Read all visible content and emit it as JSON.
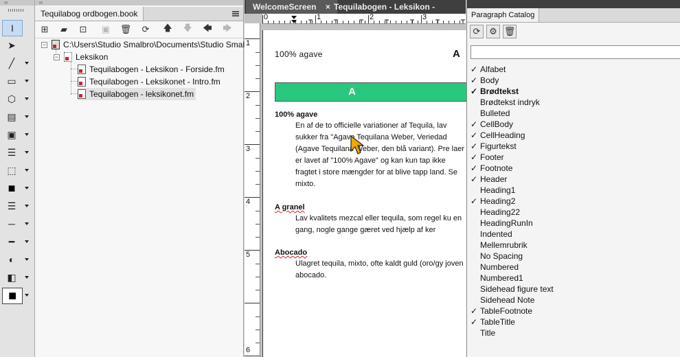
{
  "toolbox": {
    "collapse_glyph": "‹‹",
    "tools": [
      {
        "name": "smart-select-tool",
        "glyph": "I",
        "selected": true
      },
      {
        "name": "object-select-tool",
        "glyph": "➤"
      },
      {
        "name": "line-tool",
        "glyph": "╱"
      },
      {
        "name": "rectangle-tool",
        "glyph": "▭"
      },
      {
        "name": "polygon-tool",
        "glyph": "⬡"
      },
      {
        "name": "text-frame-tool",
        "glyph": "▤"
      },
      {
        "name": "graphic-frame-tool",
        "glyph": "▣"
      },
      {
        "name": "paragraph-tool",
        "glyph": "☰"
      },
      {
        "name": "selection-box-tool",
        "glyph": "⬚"
      },
      {
        "name": "fill-color-tool",
        "glyph": "■"
      },
      {
        "name": "line-width-tool",
        "glyph": "☰"
      },
      {
        "name": "line-end-tool",
        "glyph": "─"
      },
      {
        "name": "dash-tool",
        "glyph": "━"
      },
      {
        "name": "tint-tool",
        "glyph": "◐"
      },
      {
        "name": "overprint-tool",
        "glyph": "◧"
      },
      {
        "name": "stroke-color-tool",
        "glyph": "■"
      }
    ]
  },
  "book_panel": {
    "collapse_glyph": "‹‹",
    "tab_title": "Tequilabog ordbogen.book",
    "root_path": "C:\\Users\\Studio Smalbro\\Documents\\Studio Smalbro\\",
    "folder_label": "Leksikon",
    "files": [
      "Tequilabogen - Leksikon - Forside.fm",
      "Tequilabogen - Leksikonet - Intro.fm",
      "Tequilabogen - leksikonet.fm"
    ]
  },
  "doc_tabs": {
    "tabs": [
      {
        "label": "WelcomeScreen",
        "close": "×"
      },
      {
        "label": "Tequilabogen - Leksikon - Forside.fm",
        "close": ""
      }
    ]
  },
  "rulers": {
    "h_numbers": [
      "0",
      "1",
      "2",
      "3"
    ],
    "v_numbers": [
      "1",
      "2",
      "3",
      "4",
      "5",
      "6"
    ]
  },
  "document": {
    "header_left": "100% agave",
    "header_right": "A",
    "banner_letter": "A",
    "banner_color": "#2ac77f",
    "entries": [
      {
        "heading": "100% agave",
        "body": "En af de to officielle variationer af Tequila, lav sukker fra \"Agave Tequilana Weber, Veriedad (Agave Tequilana Weber, den blå variant). Pre laer er lavet af \"100% Agave\" og kan kun tap ikke fragtet i store mængder for at blive tapp land. Se mixto."
      },
      {
        "heading": "A granel",
        "body": "Lav kvalitets mezcal eller tequila, som regel ku en gang, nogle gange gæret ved hjælp af ker"
      },
      {
        "heading": "Abocado",
        "body": "Ulagret tequila, mixto, ofte kaldt guld (oro/gy joven abocado."
      }
    ]
  },
  "catalog": {
    "title": "Paragraph Catalog",
    "buttons": [
      {
        "name": "refresh-icon",
        "glyph": "⟳"
      },
      {
        "name": "gear-icon",
        "glyph": "⚙"
      },
      {
        "name": "delete-icon",
        "glyph": "🗑"
      }
    ],
    "search_placeholder": "",
    "items": [
      {
        "label": "Alfabet",
        "checked": true
      },
      {
        "label": "Body",
        "checked": true
      },
      {
        "label": "Brødtekst",
        "checked": true,
        "bold": true
      },
      {
        "label": "Brødtekst indryk",
        "checked": false
      },
      {
        "label": "Bulleted",
        "checked": false
      },
      {
        "label": "CellBody",
        "checked": true
      },
      {
        "label": "CellHeading",
        "checked": true
      },
      {
        "label": "Figurtekst",
        "checked": true
      },
      {
        "label": "Footer",
        "checked": true
      },
      {
        "label": "Footnote",
        "checked": true
      },
      {
        "label": "Header",
        "checked": true
      },
      {
        "label": "Heading1",
        "checked": false
      },
      {
        "label": "Heading2",
        "checked": true
      },
      {
        "label": "Heading22",
        "checked": false
      },
      {
        "label": "HeadingRunIn",
        "checked": false
      },
      {
        "label": "Indented",
        "checked": false
      },
      {
        "label": "Mellemrubrik",
        "checked": false
      },
      {
        "label": "No Spacing",
        "checked": false
      },
      {
        "label": "Numbered",
        "checked": false
      },
      {
        "label": "Numbered1",
        "checked": false
      },
      {
        "label": "Sidehead figure text",
        "checked": false
      },
      {
        "label": "Sidehead Note",
        "checked": false
      },
      {
        "label": "TableFootnote",
        "checked": true
      },
      {
        "label": "TableTitle",
        "checked": true
      },
      {
        "label": "Title",
        "checked": false
      }
    ],
    "check_glyph": "✓"
  }
}
